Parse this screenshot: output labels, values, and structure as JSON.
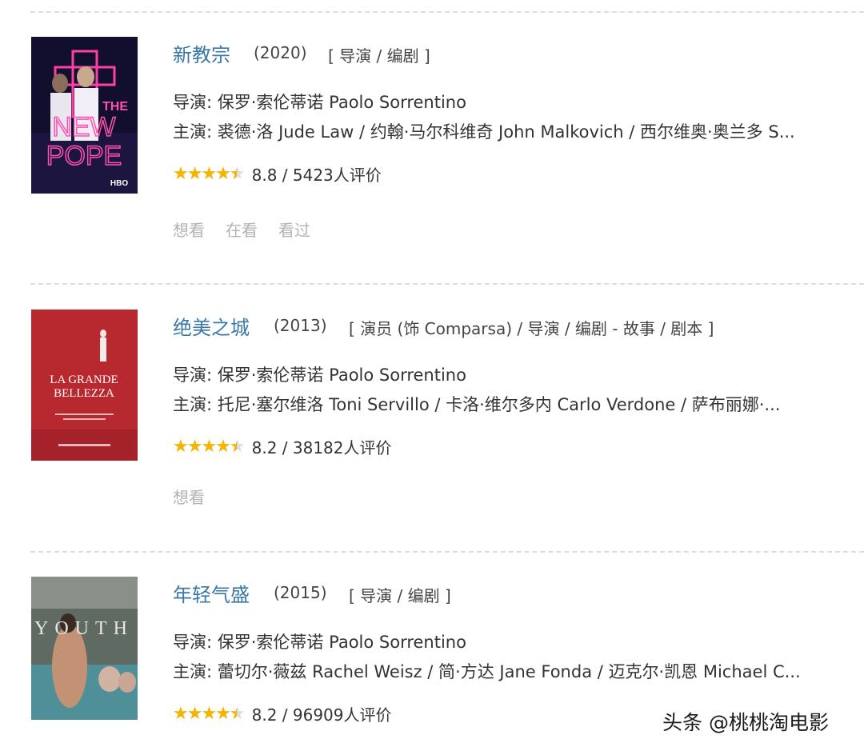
{
  "movies": [
    {
      "title": "新教宗",
      "year": "(2020)",
      "roles": "[ 导演 / 编剧 ]",
      "director": "导演: 保罗·索伦蒂诺 Paolo Sorrentino",
      "cast": "主演: 裘德·洛 Jude Law / 约翰·马尔科维奇 John Malkovich / 西尔维奥·奥兰多 S...",
      "rating_value": 8.8,
      "rating_text": "8.8 / 5423人评价",
      "star_fill_fraction": 0.9,
      "actions": [
        "想看",
        "在看",
        "看过"
      ],
      "poster": {
        "lines": [
          "THE",
          "NEW",
          "POPE"
        ],
        "badge": "HBO"
      }
    },
    {
      "title": "绝美之城",
      "year": "(2013)",
      "roles": "[ 演员 (饰 Comparsa) / 导演 / 编剧 - 故事 / 剧本 ]",
      "director": "导演: 保罗·索伦蒂诺 Paolo Sorrentino",
      "cast": "主演: 托尼·塞尔维洛 Toni Servillo / 卡洛·维尔多内 Carlo Verdone / 萨布丽娜·...",
      "rating_value": 8.2,
      "rating_text": "8.2 / 38182人评价",
      "star_fill_fraction": 0.9,
      "actions": [
        "想看"
      ],
      "poster": {
        "lines": [
          "LA GRANDE",
          "BELLEZZA"
        ]
      }
    },
    {
      "title": "年轻气盛",
      "year": "(2015)",
      "roles": "[ 导演 / 编剧 ]",
      "director": "导演: 保罗·索伦蒂诺 Paolo Sorrentino",
      "cast": "主演: 蕾切尔·薇兹 Rachel Weisz / 简·方达 Jane Fonda / 迈克尔·凯恩 Michael C...",
      "rating_value": 8.2,
      "rating_text": "8.2 / 96909人评价",
      "star_fill_fraction": 0.9,
      "actions": [],
      "poster": {
        "lines": [
          "YOUTH"
        ]
      }
    }
  ],
  "stars_glyphs": "★★★★★",
  "watermark": "头条 @桃桃淘电影",
  "colors": {
    "title": "#3a78a8",
    "star": "#f4b400",
    "action": "#b3b3b3"
  }
}
